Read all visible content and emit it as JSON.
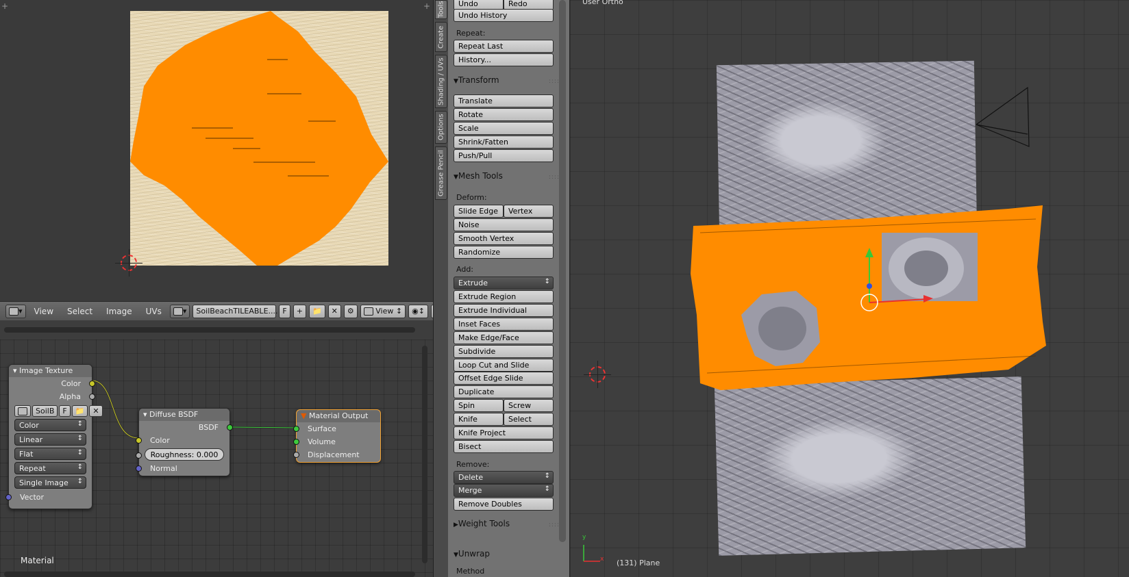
{
  "uv_header": {
    "menus": [
      "View",
      "Select",
      "Image",
      "UVs"
    ],
    "image_name": "SoilBeachTILEABLE....",
    "fake_user": "F",
    "view_mode": "View"
  },
  "nodes": {
    "image_texture": {
      "title": "Image Texture",
      "out_color": "Color",
      "out_alpha": "Alpha",
      "image_short": "SoilB",
      "fake_user": "F",
      "color_space": "Color",
      "interpolation": "Linear",
      "projection": "Flat",
      "extension": "Repeat",
      "source": "Single Image",
      "in_vector": "Vector"
    },
    "diffuse": {
      "title": "Diffuse BSDF",
      "out_bsdf": "BSDF",
      "in_color": "Color",
      "roughness": "Roughness:  0.000",
      "in_normal": "Normal"
    },
    "output": {
      "title": "Material Output",
      "surface": "Surface",
      "volume": "Volume",
      "displacement": "Displacement"
    },
    "footer_label": "Material"
  },
  "tabs": [
    "Tools",
    "Create",
    "Shading / UVs",
    "Options",
    "Grease Pencil"
  ],
  "toolshelf": {
    "undo": "Undo",
    "redo": "Redo",
    "undo_history": "Undo History",
    "repeat_label": "Repeat:",
    "repeat_last": "Repeat Last",
    "history": "History...",
    "transform_panel": "Transform",
    "translate": "Translate",
    "rotate": "Rotate",
    "scale": "Scale",
    "shrink_fatten": "Shrink/Fatten",
    "push_pull": "Push/Pull",
    "mesh_tools_panel": "Mesh Tools",
    "deform_label": "Deform:",
    "slide_edge": "Slide Edge",
    "vertex": "Vertex",
    "noise": "Noise",
    "smooth_vertex": "Smooth Vertex",
    "randomize": "Randomize",
    "add_label": "Add:",
    "extrude": "Extrude",
    "extrude_region": "Extrude Region",
    "extrude_individual": "Extrude Individual",
    "inset_faces": "Inset Faces",
    "make_edge_face": "Make Edge/Face",
    "subdivide": "Subdivide",
    "loop_cut": "Loop Cut and Slide",
    "offset_edge_slide": "Offset Edge Slide",
    "duplicate": "Duplicate",
    "spin": "Spin",
    "screw": "Screw",
    "knife": "Knife",
    "select": "Select",
    "knife_project": "Knife Project",
    "bisect": "Bisect",
    "remove_label": "Remove:",
    "delete": "Delete",
    "merge": "Merge",
    "remove_doubles": "Remove Doubles",
    "weight_tools_panel": "Weight Tools",
    "unwrap_panel": "Unwrap",
    "method_label": "Method"
  },
  "viewport": {
    "view_name": "User Ortho",
    "object_info": "(131) Plane",
    "axis_y": "y",
    "axis_x": "x"
  },
  "colors": {
    "selection_orange": "#ff8c00",
    "uv_image_bg": "#e8d9b6"
  }
}
